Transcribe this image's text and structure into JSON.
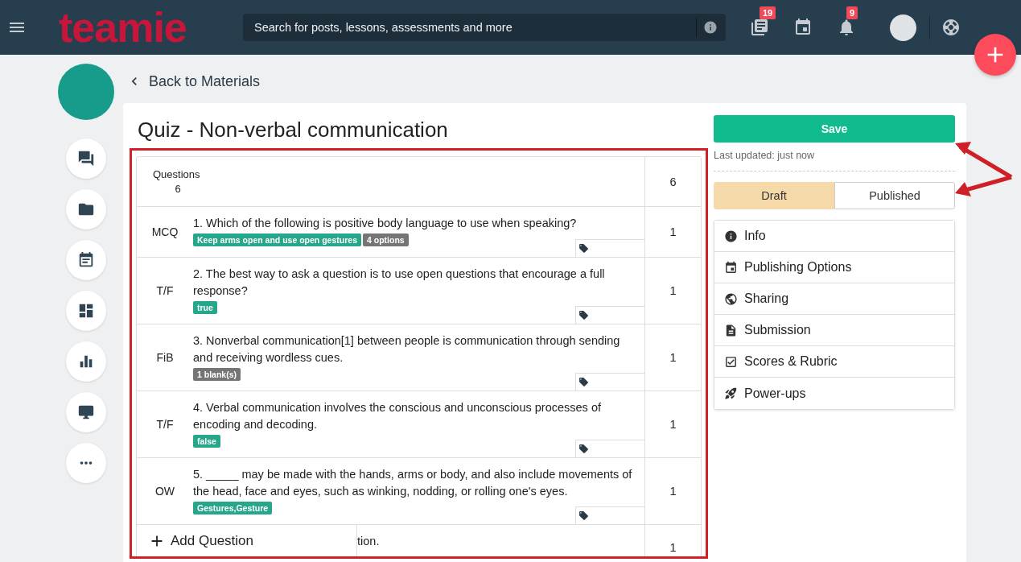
{
  "header": {
    "logo": "teamie",
    "search": {
      "placeholder": "Search for posts, lessons, assessments and more"
    },
    "actions": [
      {
        "kind": "library",
        "badge": "19"
      },
      {
        "kind": "calendar"
      },
      {
        "kind": "notifications",
        "badge": "9"
      }
    ]
  },
  "back_link": "Back to Materials",
  "title": "Quiz - Non-verbal communication",
  "table": {
    "header": {
      "label": "Questions",
      "count": "6",
      "points": "6"
    },
    "rows": [
      {
        "type": "MCQ",
        "text": "1. Which of the following is positive body language to use when speaking?",
        "tags": [
          {
            "label": "Keep arms open and use open gestures",
            "kind": "answer"
          },
          {
            "label": "4 options",
            "kind": "count"
          }
        ],
        "points": "1"
      },
      {
        "type": "T/F",
        "text": "2. The best way to ask a question is to use open questions that encourage a full response?",
        "tags": [
          {
            "label": "true",
            "kind": "answer"
          }
        ],
        "points": "1"
      },
      {
        "type": "FiB",
        "text": "3. Nonverbal communication[1] between people is communication through sending and receiving wordless cues.",
        "tags": [
          {
            "label": "1 blank(s)",
            "kind": "count"
          }
        ],
        "points": "1"
      },
      {
        "type": "T/F",
        "text": "4. Verbal communication involves the conscious and unconscious processes of encoding and decoding.",
        "tags": [
          {
            "label": "false",
            "kind": "answer"
          }
        ],
        "points": "1"
      },
      {
        "type": "OW",
        "text": "5. _____ may be made with the hands, arms or body, and also include movements of the head, face and eyes, such as winking, nodding, or rolling one's eyes.",
        "tags": [
          {
            "label": "Gestures,Gesture",
            "kind": "answer"
          }
        ],
        "points": "1"
      },
      {
        "text": "tion.",
        "tags": [],
        "points": "1"
      }
    ]
  },
  "add_question": "Add Question",
  "save": "Save",
  "last_updated": "Last updated: just now",
  "status": [
    {
      "label": "Draft",
      "selected": true
    },
    {
      "label": "Published",
      "selected": false
    }
  ],
  "menu": [
    "Info",
    "Publishing Options",
    "Sharing",
    "Submission",
    "Scores & Rubric",
    "Power-ups"
  ]
}
